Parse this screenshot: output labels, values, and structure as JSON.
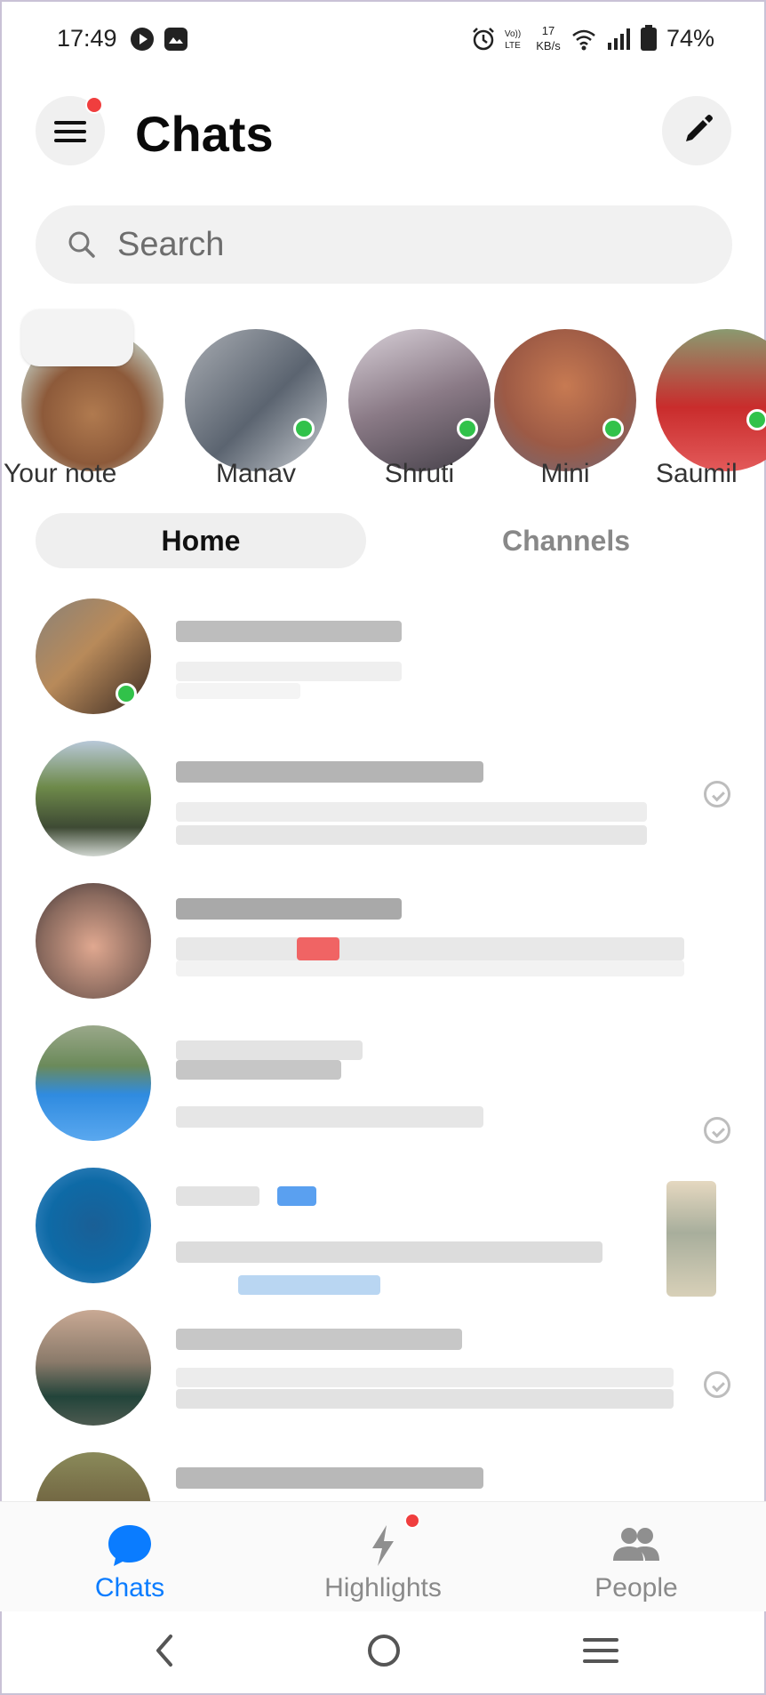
{
  "status_bar": {
    "time": "17:49",
    "net_speed_value": "17",
    "net_speed_unit": "KB/s",
    "volte_line1": "Vo))",
    "volte_line2": "LTE",
    "battery": "74%"
  },
  "header": {
    "title": "Chats",
    "menu_has_notification": true,
    "compose_icon": "pencil-icon"
  },
  "search": {
    "placeholder": "Search",
    "value": ""
  },
  "stories": [
    {
      "label": "Your note",
      "kind": "note"
    },
    {
      "label": "Manav",
      "kind": "contact",
      "online": true
    },
    {
      "label": "Shruti",
      "kind": "contact",
      "online": true
    },
    {
      "label": "Mini",
      "kind": "contact",
      "online": true
    },
    {
      "label": "Saumil",
      "kind": "contact",
      "online": true
    }
  ],
  "segments": {
    "home": "Home",
    "channels": "Channels",
    "selected": "Home"
  },
  "chats": [
    {
      "state": "unread",
      "status": "online"
    },
    {
      "state": "read",
      "status": "seen"
    },
    {
      "state": "unread",
      "status": "none"
    },
    {
      "state": "read",
      "status": "seen"
    },
    {
      "state": "read",
      "status": "thumbnail"
    },
    {
      "state": "read",
      "status": "seen"
    },
    {
      "state": "read",
      "status": "none"
    }
  ],
  "bottom_nav": {
    "chats": "Chats",
    "highlights": "Highlights",
    "people": "People",
    "active": "Chats",
    "highlights_has_notification": true
  },
  "colors": {
    "accent": "#0a7cff",
    "notification": "#f03e3e",
    "online": "#31c24a",
    "inactive_text": "#8a8a8a"
  },
  "icons": {
    "status": [
      "play-icon",
      "image-icon",
      "alarm-icon",
      "volte-icon",
      "wifi-icon",
      "signal-icon",
      "battery-icon"
    ],
    "system_nav": [
      "back-icon",
      "home-icon",
      "recents-icon"
    ]
  }
}
